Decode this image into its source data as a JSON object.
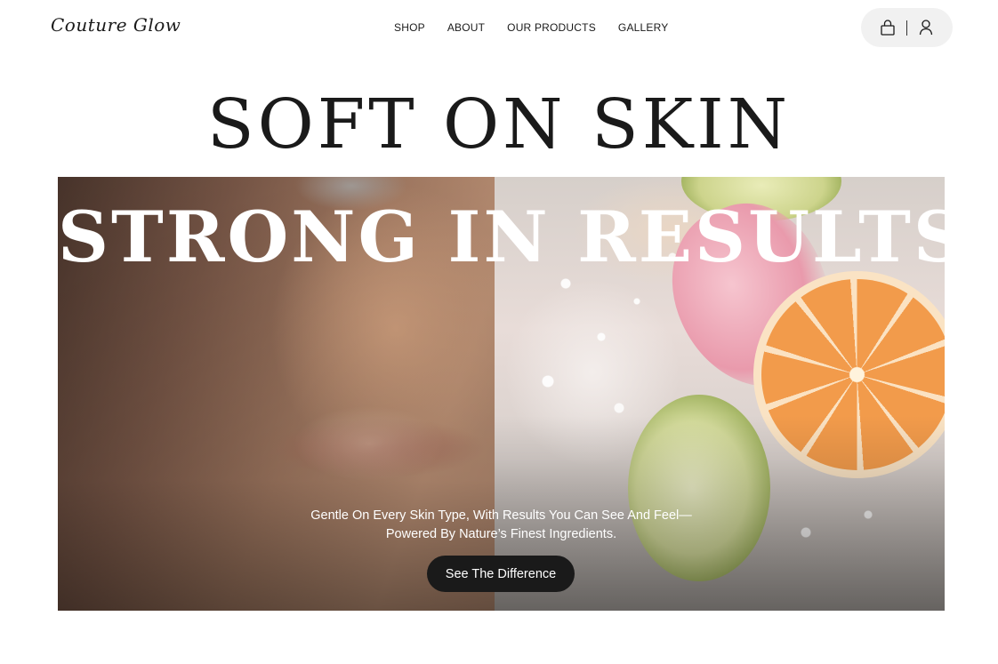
{
  "brand": {
    "logo_text": "Couture Glow"
  },
  "nav": {
    "items": [
      {
        "label": "SHOP"
      },
      {
        "label": "ABOUT"
      },
      {
        "label": "OUR PRODUCTS"
      },
      {
        "label": "GALLERY"
      }
    ]
  },
  "header_icons": {
    "cart": "shopping-bag-icon",
    "account": "user-icon"
  },
  "hero": {
    "headline_top": "SOFT ON SKIN",
    "headline_overlay": "STRONG IN RESULTS",
    "copy_line_1": "Gentle On Every Skin Type, With Results You Can See And Feel—",
    "copy_line_2": "Powered By Nature’s Finest Ingredients.",
    "cta_label": "See The Difference"
  },
  "colors": {
    "text": "#1a1a1a",
    "background": "#ffffff",
    "icon_pill": "#f1f1f1",
    "cta_background": "#1a1a1a",
    "cta_text": "#ffffff"
  }
}
